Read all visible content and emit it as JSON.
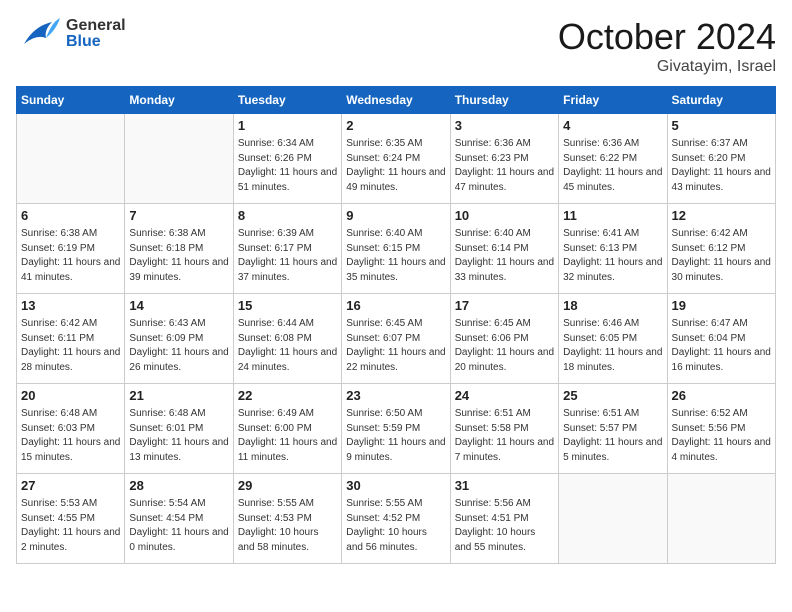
{
  "header": {
    "logo_general": "General",
    "logo_blue": "Blue",
    "month": "October 2024",
    "location": "Givatayim, Israel"
  },
  "days_of_week": [
    "Sunday",
    "Monday",
    "Tuesday",
    "Wednesday",
    "Thursday",
    "Friday",
    "Saturday"
  ],
  "weeks": [
    [
      {
        "day": "",
        "info": ""
      },
      {
        "day": "",
        "info": ""
      },
      {
        "day": "1",
        "info": "Sunrise: 6:34 AM\nSunset: 6:26 PM\nDaylight: 11 hours and 51 minutes."
      },
      {
        "day": "2",
        "info": "Sunrise: 6:35 AM\nSunset: 6:24 PM\nDaylight: 11 hours and 49 minutes."
      },
      {
        "day": "3",
        "info": "Sunrise: 6:36 AM\nSunset: 6:23 PM\nDaylight: 11 hours and 47 minutes."
      },
      {
        "day": "4",
        "info": "Sunrise: 6:36 AM\nSunset: 6:22 PM\nDaylight: 11 hours and 45 minutes."
      },
      {
        "day": "5",
        "info": "Sunrise: 6:37 AM\nSunset: 6:20 PM\nDaylight: 11 hours and 43 minutes."
      }
    ],
    [
      {
        "day": "6",
        "info": "Sunrise: 6:38 AM\nSunset: 6:19 PM\nDaylight: 11 hours and 41 minutes."
      },
      {
        "day": "7",
        "info": "Sunrise: 6:38 AM\nSunset: 6:18 PM\nDaylight: 11 hours and 39 minutes."
      },
      {
        "day": "8",
        "info": "Sunrise: 6:39 AM\nSunset: 6:17 PM\nDaylight: 11 hours and 37 minutes."
      },
      {
        "day": "9",
        "info": "Sunrise: 6:40 AM\nSunset: 6:15 PM\nDaylight: 11 hours and 35 minutes."
      },
      {
        "day": "10",
        "info": "Sunrise: 6:40 AM\nSunset: 6:14 PM\nDaylight: 11 hours and 33 minutes."
      },
      {
        "day": "11",
        "info": "Sunrise: 6:41 AM\nSunset: 6:13 PM\nDaylight: 11 hours and 32 minutes."
      },
      {
        "day": "12",
        "info": "Sunrise: 6:42 AM\nSunset: 6:12 PM\nDaylight: 11 hours and 30 minutes."
      }
    ],
    [
      {
        "day": "13",
        "info": "Sunrise: 6:42 AM\nSunset: 6:11 PM\nDaylight: 11 hours and 28 minutes."
      },
      {
        "day": "14",
        "info": "Sunrise: 6:43 AM\nSunset: 6:09 PM\nDaylight: 11 hours and 26 minutes."
      },
      {
        "day": "15",
        "info": "Sunrise: 6:44 AM\nSunset: 6:08 PM\nDaylight: 11 hours and 24 minutes."
      },
      {
        "day": "16",
        "info": "Sunrise: 6:45 AM\nSunset: 6:07 PM\nDaylight: 11 hours and 22 minutes."
      },
      {
        "day": "17",
        "info": "Sunrise: 6:45 AM\nSunset: 6:06 PM\nDaylight: 11 hours and 20 minutes."
      },
      {
        "day": "18",
        "info": "Sunrise: 6:46 AM\nSunset: 6:05 PM\nDaylight: 11 hours and 18 minutes."
      },
      {
        "day": "19",
        "info": "Sunrise: 6:47 AM\nSunset: 6:04 PM\nDaylight: 11 hours and 16 minutes."
      }
    ],
    [
      {
        "day": "20",
        "info": "Sunrise: 6:48 AM\nSunset: 6:03 PM\nDaylight: 11 hours and 15 minutes."
      },
      {
        "day": "21",
        "info": "Sunrise: 6:48 AM\nSunset: 6:01 PM\nDaylight: 11 hours and 13 minutes."
      },
      {
        "day": "22",
        "info": "Sunrise: 6:49 AM\nSunset: 6:00 PM\nDaylight: 11 hours and 11 minutes."
      },
      {
        "day": "23",
        "info": "Sunrise: 6:50 AM\nSunset: 5:59 PM\nDaylight: 11 hours and 9 minutes."
      },
      {
        "day": "24",
        "info": "Sunrise: 6:51 AM\nSunset: 5:58 PM\nDaylight: 11 hours and 7 minutes."
      },
      {
        "day": "25",
        "info": "Sunrise: 6:51 AM\nSunset: 5:57 PM\nDaylight: 11 hours and 5 minutes."
      },
      {
        "day": "26",
        "info": "Sunrise: 6:52 AM\nSunset: 5:56 PM\nDaylight: 11 hours and 4 minutes."
      }
    ],
    [
      {
        "day": "27",
        "info": "Sunrise: 5:53 AM\nSunset: 4:55 PM\nDaylight: 11 hours and 2 minutes."
      },
      {
        "day": "28",
        "info": "Sunrise: 5:54 AM\nSunset: 4:54 PM\nDaylight: 11 hours and 0 minutes."
      },
      {
        "day": "29",
        "info": "Sunrise: 5:55 AM\nSunset: 4:53 PM\nDaylight: 10 hours and 58 minutes."
      },
      {
        "day": "30",
        "info": "Sunrise: 5:55 AM\nSunset: 4:52 PM\nDaylight: 10 hours and 56 minutes."
      },
      {
        "day": "31",
        "info": "Sunrise: 5:56 AM\nSunset: 4:51 PM\nDaylight: 10 hours and 55 minutes."
      },
      {
        "day": "",
        "info": ""
      },
      {
        "day": "",
        "info": ""
      }
    ]
  ]
}
